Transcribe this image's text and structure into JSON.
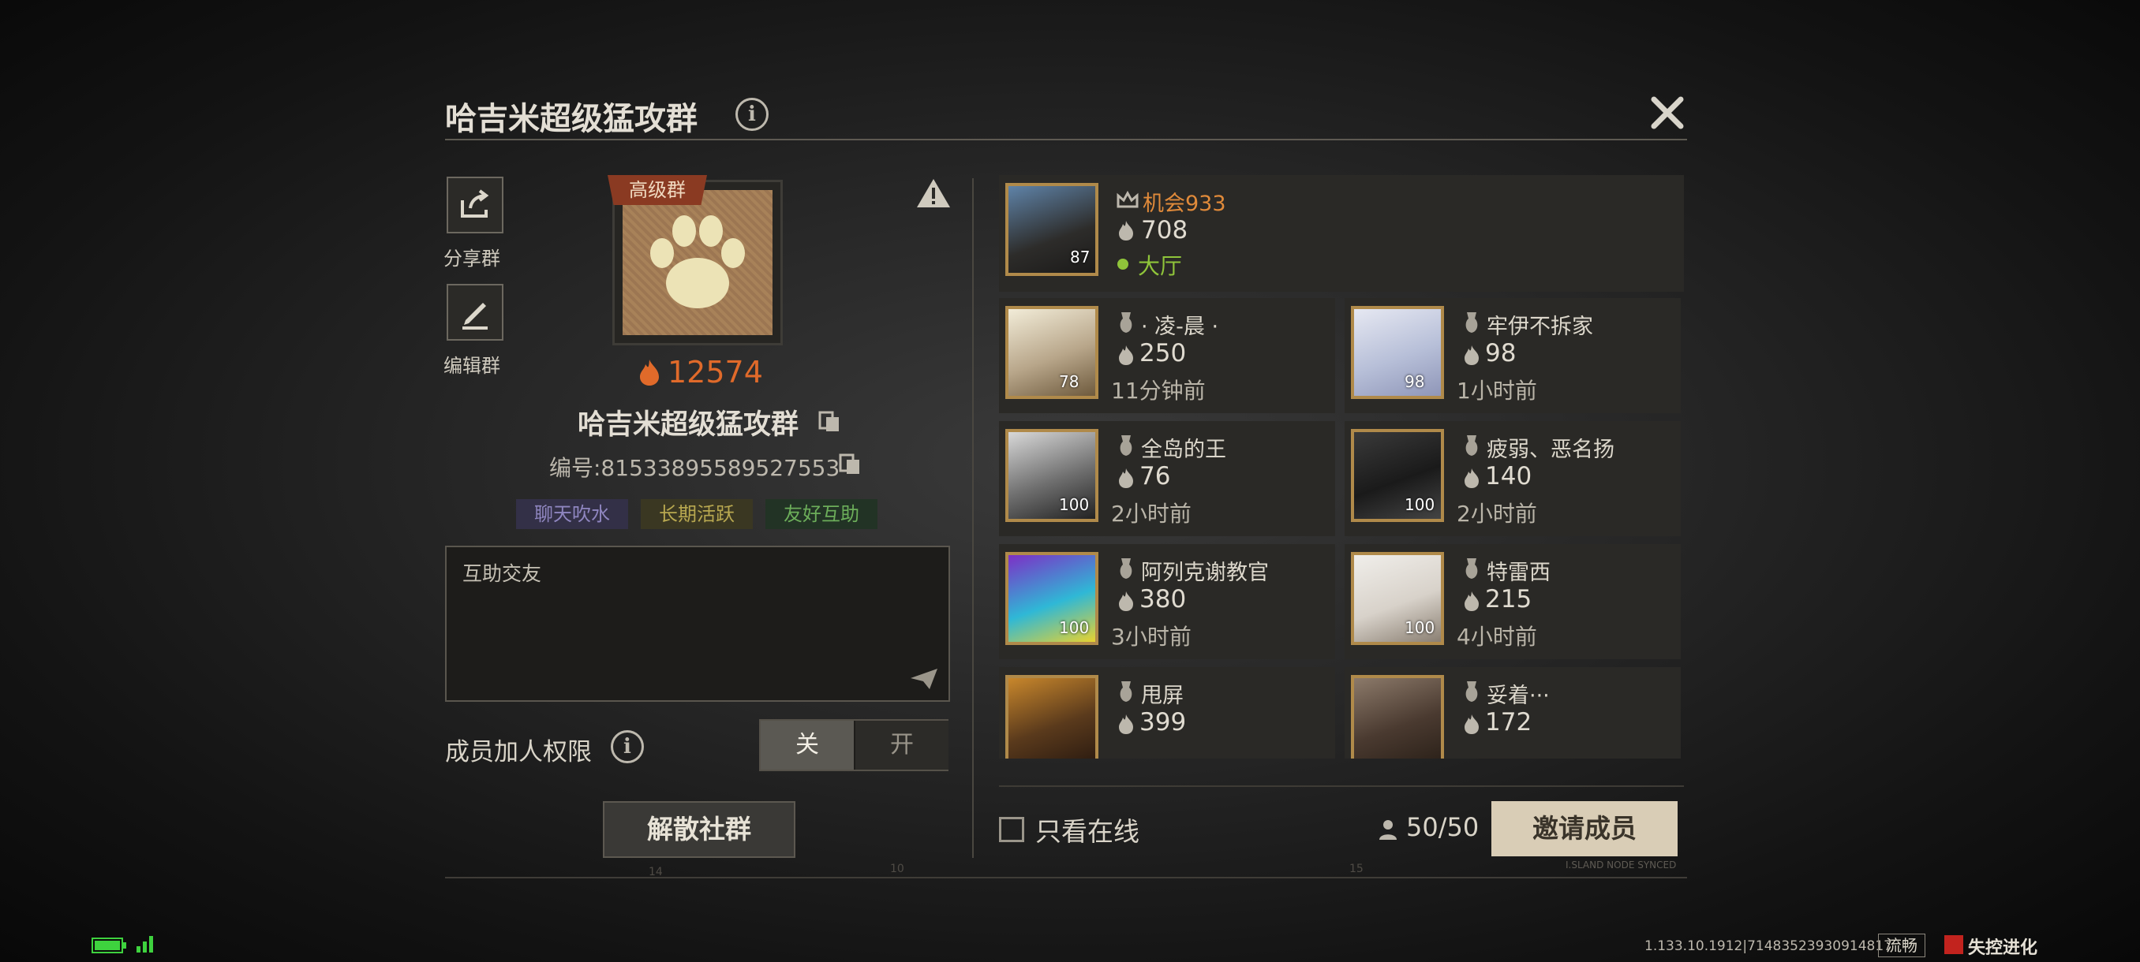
{
  "header": {
    "title": "哈吉米超级猛攻群"
  },
  "sidebar": {
    "share_label": "分享群",
    "edit_label": "编辑群"
  },
  "group": {
    "badge": "高级群",
    "heat": "12574",
    "name": "哈吉米超级猛攻群",
    "id_text": "编号:815338955895275​53",
    "tags": [
      "聊天吹水",
      "长期活跃",
      "友好互助"
    ],
    "description": "互助交友"
  },
  "permission": {
    "label": "成员加人权限",
    "off_label": "关",
    "on_label": "开",
    "selected": "关"
  },
  "disband_label": "解散社群",
  "leader": {
    "name": "机会933",
    "score": "708",
    "status": "大厅",
    "level": "87"
  },
  "members": [
    {
      "name": "· 凌-晨 ·",
      "score": "250",
      "status": "11分钟前",
      "level": "78"
    },
    {
      "name": "牢伊不拆家",
      "score": "98",
      "status": "1小时前",
      "level": "98"
    },
    {
      "name": "全岛的王",
      "score": "76",
      "status": "2小时前",
      "level": "100"
    },
    {
      "name": "疲弱、恶名扬",
      "score": "140",
      "status": "2小时前",
      "level": "100"
    },
    {
      "name": "阿列克谢教官",
      "score": "380",
      "status": "3小时前",
      "level": "100"
    },
    {
      "name": "特雷西",
      "score": "215",
      "status": "4小时前",
      "level": "100"
    },
    {
      "name": "甩屏",
      "score": "399",
      "status": "",
      "level": ""
    },
    {
      "name": "妥着···",
      "score": "172",
      "status": "",
      "level": ""
    }
  ],
  "footer": {
    "online_only_label": "只看在线",
    "member_count": "50/50",
    "invite_label": "邀请成员"
  },
  "deco": {
    "island": "I.SLAND NODE SYNCED",
    "tick1": "14",
    "tick2": "10",
    "tick3": "15"
  },
  "status_bar": {
    "version": "1.133.10.1912|714835239309148​17",
    "network": "流畅",
    "game_logo": "失控进化"
  },
  "colors": {
    "accent_orange": "#e06a2a",
    "online_green": "#8fc43a",
    "leader_name": "#e08a3a"
  },
  "icons": [
    "share-icon",
    "edit-icon",
    "info-icon",
    "close-icon",
    "warning-icon",
    "fire-icon",
    "copy-icon",
    "send-icon",
    "crown-icon",
    "rank-icon",
    "person-icon",
    "battery-icon",
    "signal-icon"
  ]
}
